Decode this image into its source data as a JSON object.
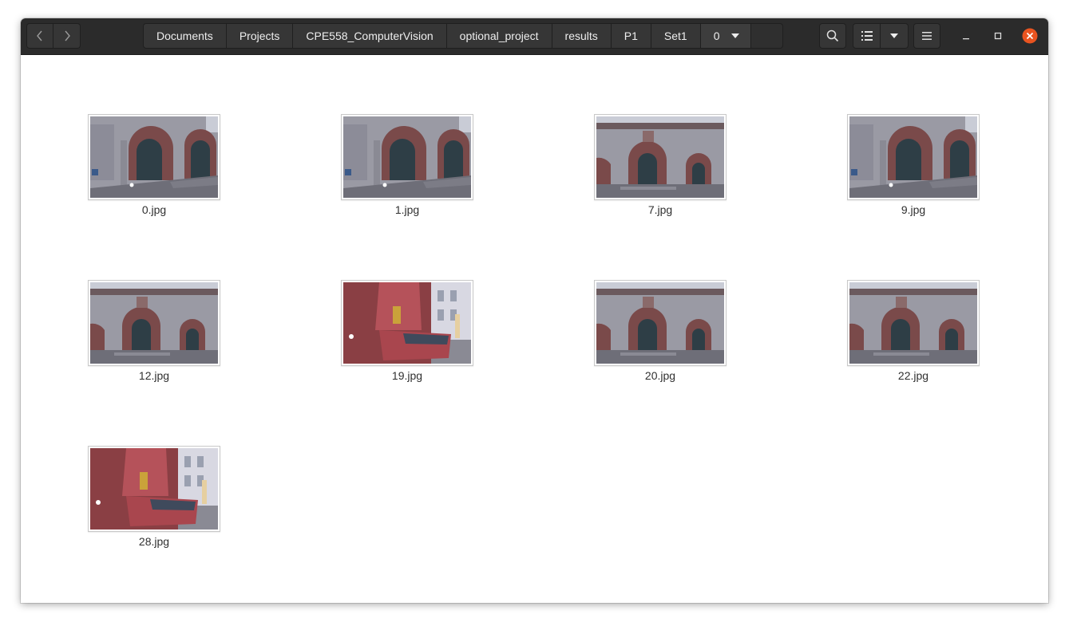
{
  "nav": {
    "back_icon": "chevron-left-icon",
    "forward_icon": "chevron-right-icon"
  },
  "pathbar": {
    "crumbs": [
      "Documents",
      "Projects",
      "CPE558_ComputerVision",
      "optional_project",
      "results",
      "P1",
      "Set1"
    ],
    "current": "0",
    "current_icon": "chevron-down-icon"
  },
  "toolbar": {
    "search_icon": "search-icon",
    "view_icon": "list-view-icon",
    "view_options_icon": "chevron-down-icon",
    "menu_icon": "hamburger-menu-icon"
  },
  "window_controls": {
    "minimize_icon": "minimize-icon",
    "maximize_icon": "maximize-icon",
    "close_icon": "close-icon",
    "close_color": "#e95420"
  },
  "files": [
    {
      "name": "0.jpg",
      "scene": "church-angled"
    },
    {
      "name": "1.jpg",
      "scene": "church-angled"
    },
    {
      "name": "7.jpg",
      "scene": "church-front"
    },
    {
      "name": "9.jpg",
      "scene": "church-angled"
    },
    {
      "name": "12.jpg",
      "scene": "church-front"
    },
    {
      "name": "19.jpg",
      "scene": "fountain"
    },
    {
      "name": "20.jpg",
      "scene": "church-front"
    },
    {
      "name": "22.jpg",
      "scene": "church-front"
    },
    {
      "name": "28.jpg",
      "scene": "fountain"
    }
  ],
  "colors": {
    "headerbar": "#2b2b2b",
    "stone": "#9a9aa4",
    "sandstone": "#7a4a4a",
    "sky": "#c9ccd6",
    "ground": "#6e6e78",
    "fountain": "#b5525a",
    "brick": "#8a3f44"
  }
}
